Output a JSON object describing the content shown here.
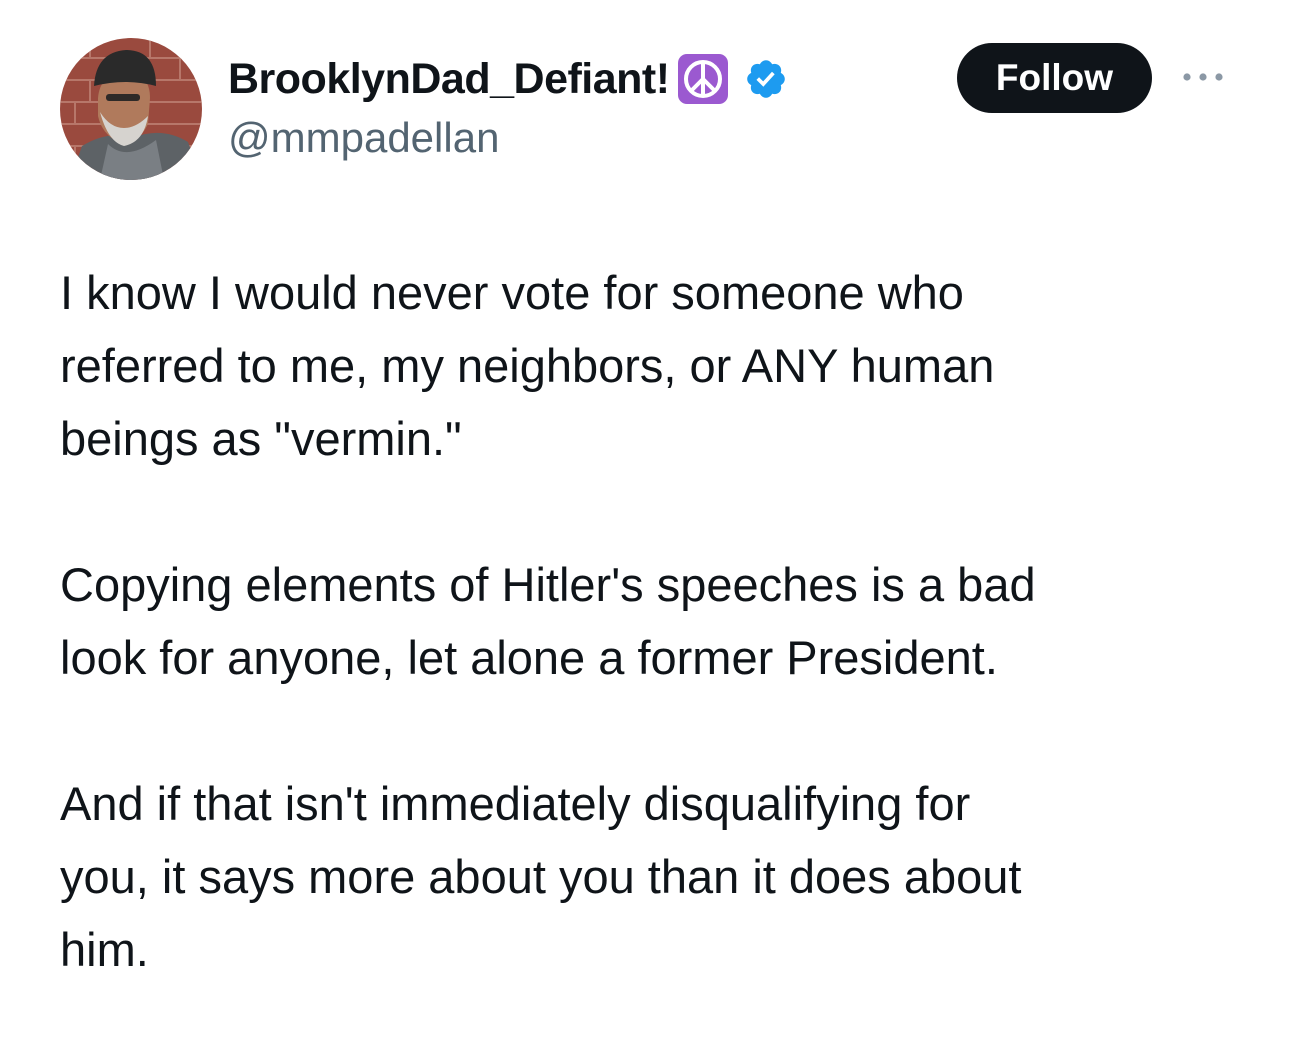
{
  "author": {
    "display_name": "BrooklynDad_Defiant!",
    "name_emoji_icon": "peace-symbol-icon",
    "verified_icon": "verified-badge-icon",
    "handle": "@mmpadellan",
    "avatar": "profile-photo"
  },
  "actions": {
    "follow_label": "Follow",
    "more_icon": "more-options-icon"
  },
  "tweet": {
    "paragraphs": [
      {
        "lines": [
          "I know I would never vote for someone who",
          "referred to me, my neighbors, or ANY human",
          "beings as \"vermin.\""
        ]
      },
      {
        "lines": [
          "Copying elements of Hitler's speeches is a bad",
          "look for anyone, let alone a former President."
        ]
      },
      {
        "lines": [
          "And if that isn't immediately disqualifying for",
          "you, it says more about you than it does about",
          "him."
        ]
      }
    ]
  },
  "colors": {
    "text_primary": "#0f1419",
    "text_secondary": "#536471",
    "follow_bg": "#0f1419",
    "verified_blue": "#1d9bf0",
    "peace_purple": "#9b59d0"
  }
}
